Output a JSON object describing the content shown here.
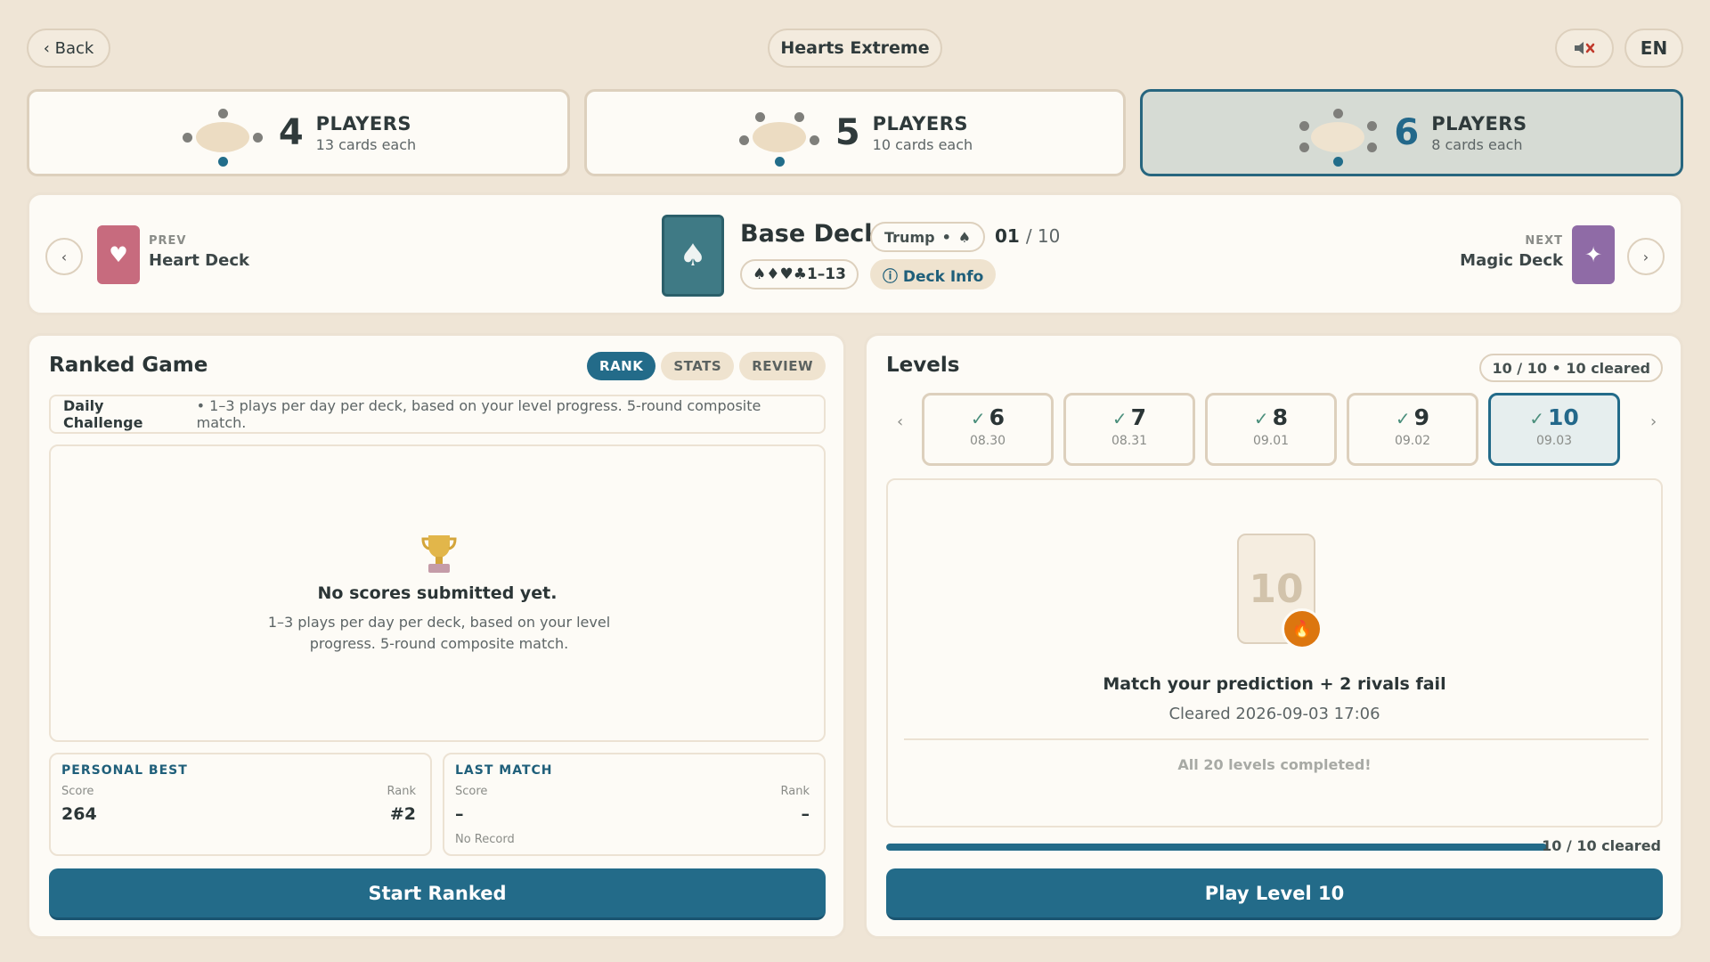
{
  "header": {
    "back_label": "‹ Back",
    "title": "Hearts Extreme",
    "mute_icon": "mute-icon",
    "lang": "EN"
  },
  "player_modes": [
    {
      "count": "4",
      "label": "PLAYERS",
      "sub": "13 cards each",
      "selected": false
    },
    {
      "count": "5",
      "label": "PLAYERS",
      "sub": "10 cards each",
      "selected": false
    },
    {
      "count": "6",
      "label": "PLAYERS",
      "sub": "8 cards each",
      "selected": true
    }
  ],
  "deck": {
    "prev_caption": "PREV",
    "prev_name": "Heart Deck",
    "prev_color": "#c76b7e",
    "next_caption": "NEXT",
    "next_name": "Magic Deck",
    "next_color": "#8f6ba6",
    "current_name": "Base Deck",
    "trump_label": "Trump",
    "trump_suit": "♠",
    "index": "01",
    "total": "/ 10",
    "suits": "♠♦♥♣1–13",
    "info_label": "ⓘ Deck Info"
  },
  "ranked": {
    "title": "Ranked Game",
    "tabs": [
      "RANK",
      "STATS",
      "REVIEW"
    ],
    "active_tab": "RANK",
    "daily_label": "Daily Challenge",
    "daily_text": "• 1–3 plays per day per deck, based on your level progress. 5-round composite match.",
    "empty_title": "No scores submitted yet.",
    "empty_text": "1–3 plays per day per deck, based on your level progress. 5-round composite match.",
    "personal_best": {
      "title": "PERSONAL BEST",
      "score_label": "Score",
      "rank_label": "Rank",
      "score": "264",
      "rank": "#2"
    },
    "last_match": {
      "title": "LAST MATCH",
      "score_label": "Score",
      "rank_label": "Rank",
      "score": "–",
      "rank": "–",
      "note": "No Record"
    },
    "start_label": "Start Ranked"
  },
  "levels": {
    "title": "Levels",
    "badge": "10 / 10  •  10 cleared",
    "items": [
      {
        "num": "6",
        "date": "08.30"
      },
      {
        "num": "7",
        "date": "08.31"
      },
      {
        "num": "8",
        "date": "09.01"
      },
      {
        "num": "9",
        "date": "09.02"
      },
      {
        "num": "10",
        "date": "09.03"
      }
    ],
    "selected": "10",
    "card_num": "10",
    "match_title": "Match your prediction + 2 rivals fail",
    "cleared_text": "Cleared 2026-09-03 17:06",
    "all_done": "All 20 levels completed!",
    "progress": 1.0,
    "progress_label": "10 / 10 cleared",
    "play_label": "Play Level 10"
  },
  "colors": {
    "accent": "#236b89",
    "flame": "#dc760f",
    "base_deck": "#3f7a85"
  }
}
